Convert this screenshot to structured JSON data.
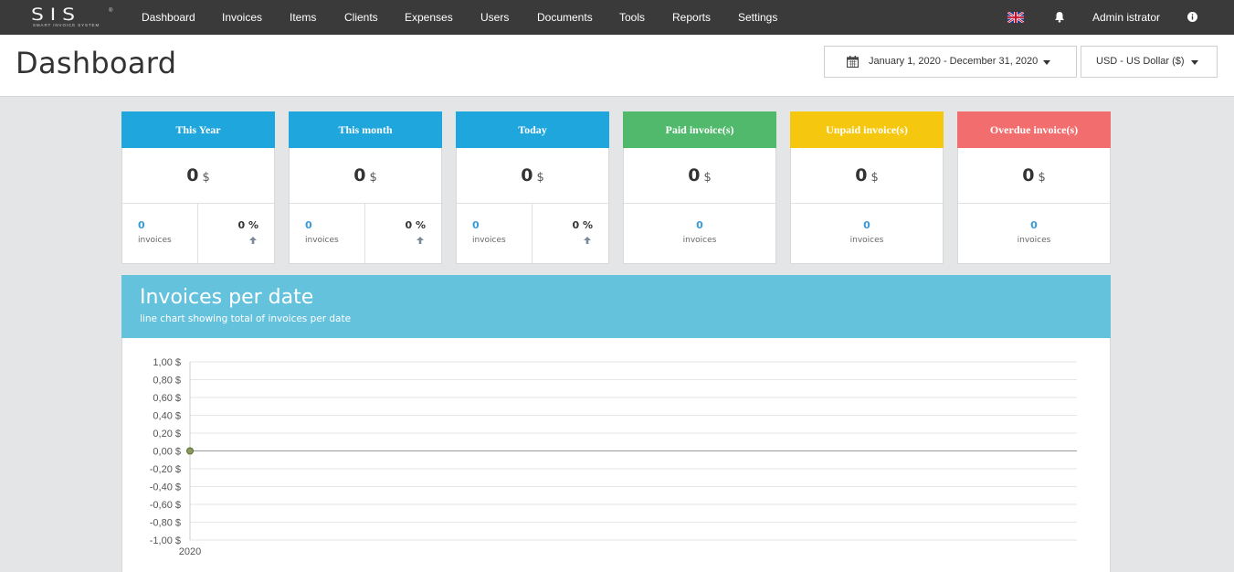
{
  "app": {
    "logo_text": "SIS",
    "logo_subtitle": "SMART INVOICE SYSTEM",
    "logo_reg": "®"
  },
  "nav": {
    "items": [
      "Dashboard",
      "Invoices",
      "Items",
      "Clients",
      "Expenses",
      "Users",
      "Documents",
      "Tools",
      "Reports",
      "Settings"
    ],
    "user": "Admin istrator",
    "icons": [
      "uk-flag-icon",
      "bell-icon",
      "info-icon"
    ]
  },
  "header": {
    "title": "Dashboard",
    "date_range": "January 1, 2020 - December 31, 2020",
    "currency": "USD - US Dollar ($)"
  },
  "cards": [
    {
      "title": "This Year",
      "value": "0",
      "currency": "$",
      "count": "0",
      "count_label": "invoices",
      "percent": "0 %",
      "color": "#1fa6dc"
    },
    {
      "title": "This month",
      "value": "0",
      "currency": "$",
      "count": "0",
      "count_label": "invoices",
      "percent": "0 %",
      "color": "#1fa6dc"
    },
    {
      "title": "Today",
      "value": "0",
      "currency": "$",
      "count": "0",
      "count_label": "invoices",
      "percent": "0 %",
      "color": "#1fa6dc"
    },
    {
      "title": "Paid invoice(s)",
      "value": "0",
      "currency": "$",
      "count": "0",
      "count_label": "invoices",
      "color": "#51b96b"
    },
    {
      "title": "Unpaid invoice(s)",
      "value": "0",
      "currency": "$",
      "count": "0",
      "count_label": "invoices",
      "color": "#f6c70f"
    },
    {
      "title": "Overdue invoice(s)",
      "value": "0",
      "currency": "$",
      "count": "0",
      "count_label": "invoices",
      "color": "#f26d6d"
    }
  ],
  "chart_panel": {
    "title": "Invoices per date",
    "subtitle": "line chart showing total of invoices per date"
  },
  "chart_data": {
    "type": "line",
    "x": [
      "2020"
    ],
    "series": [
      {
        "values": [
          0
        ]
      }
    ],
    "yticks": [
      "1,00 $",
      "0,80 $",
      "0,60 $",
      "0,40 $",
      "0,20 $",
      "0,00 $",
      "-0,20 $",
      "-0,40 $",
      "-0,60 $",
      "-0,80 $",
      "-1,00 $"
    ],
    "ylim": [
      -1,
      1
    ],
    "grid": true,
    "point_color": "#8a9a5b"
  }
}
